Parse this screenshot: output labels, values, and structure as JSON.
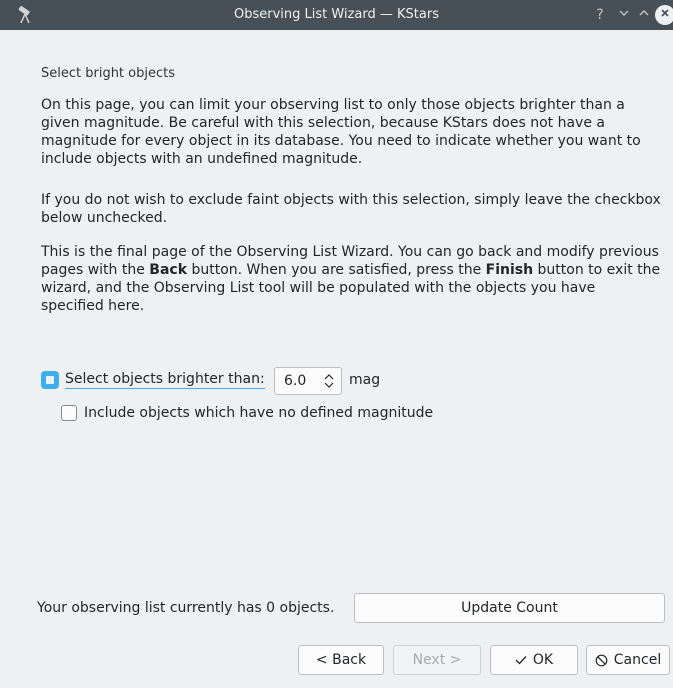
{
  "window": {
    "title": "Observing List Wizard — KStars",
    "help_glyph": "?",
    "minimize_glyph": "⌄",
    "maximize_glyph": "⌃",
    "close_glyph": "✕"
  },
  "page": {
    "heading": "Select bright objects",
    "paragraph1": "On this page, you can limit your observing list to only those objects brighter than a given magnitude. Be careful with this selection, because KStars does not have a magnitude for every object in its database. You need to indicate whether you want to include objects with an undefined magnitude.",
    "paragraph2": "If you do not wish to exclude faint objects with this selection, simply leave the checkbox below unchecked.",
    "paragraph3": {
      "part1": "This is the final page of the Observing List Wizard. You can go back and modify previous pages with the ",
      "back_bold": "Back",
      "part2": " button. When you are satisfied, press the ",
      "finish_bold": "Finish",
      "part3": " button to exit the wizard, and the Observing List tool will be populated with the objects you have specified here."
    }
  },
  "magnitude_filter": {
    "checkbox_label": "Select objects brighter than:",
    "checked": true,
    "value": "6.0",
    "unit": "mag",
    "include_undefined_label": "Include objects which have no defined magnitude",
    "include_undefined_checked": false
  },
  "count": {
    "text": "Your observing list currently has 0 objects.",
    "update_button": "Update Count"
  },
  "buttons": {
    "back": "< Back",
    "next": "Next >",
    "ok": "OK",
    "cancel": "Cancel"
  }
}
